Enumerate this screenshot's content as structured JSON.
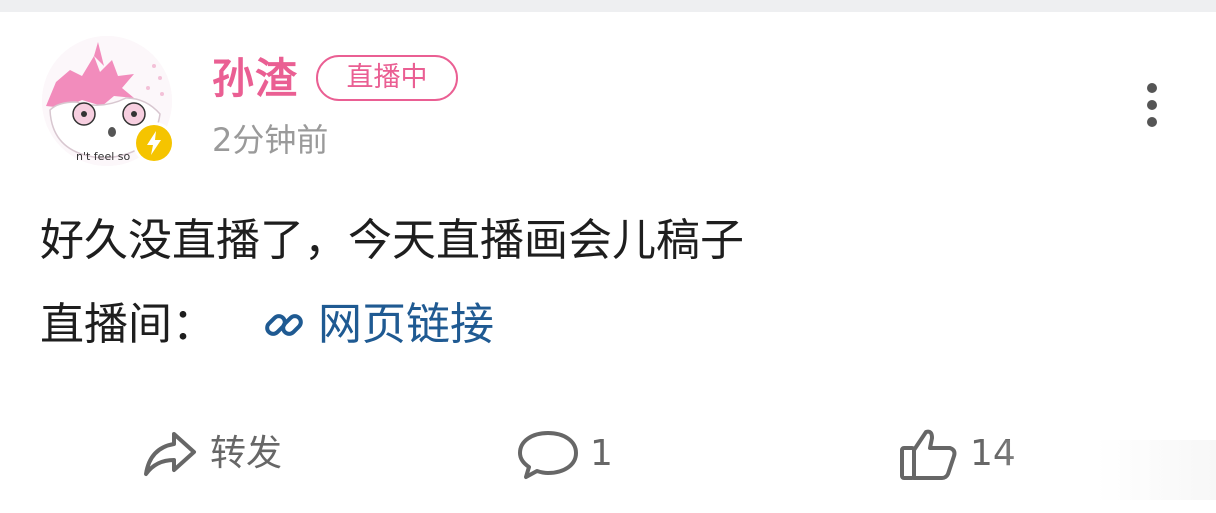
{
  "post": {
    "author": "孙渣",
    "live_badge": "直播中",
    "time": "2分钟前",
    "avatar_caption": "n't feel so",
    "text_line1": "好久没直播了，今天直播画会儿稿子",
    "text_line2_prefix": "直播间：",
    "link_label": "网页链接"
  },
  "actions": {
    "repost_label": "转发",
    "comment_count": "1",
    "like_count": "14"
  },
  "icons": {
    "badge": "lightning-icon",
    "more": "more-vertical-icon",
    "link": "link-icon",
    "repost": "share-arrow-icon",
    "comment": "comment-bubble-icon",
    "like": "thumbs-up-icon"
  },
  "colors": {
    "accent": "#ea5f93",
    "link": "#1f5a92",
    "badge": "#f5c400",
    "text": "#1e1e1e",
    "muted": "#9a9a9a",
    "action": "#676767"
  }
}
